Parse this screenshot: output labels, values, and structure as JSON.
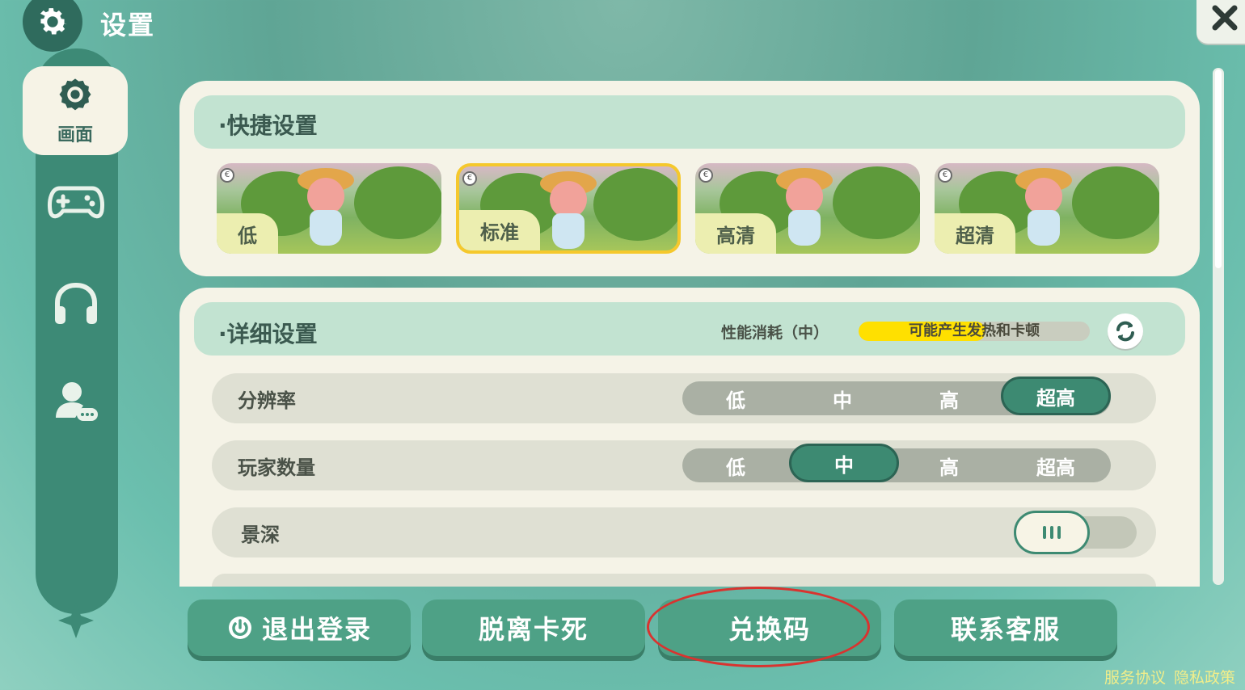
{
  "header": {
    "title": "设置",
    "settings_icon": "gear-icon",
    "close_icon": "close-icon"
  },
  "sidebar": {
    "items": [
      {
        "label": "画面",
        "icon": "display-icon",
        "active": true
      },
      {
        "label": "",
        "icon": "gamepad-icon",
        "active": false
      },
      {
        "label": "",
        "icon": "headphones-icon",
        "active": false
      },
      {
        "label": "",
        "icon": "user-chat-icon",
        "active": false
      }
    ]
  },
  "quick": {
    "title": "·快捷设置",
    "presets": [
      {
        "label": "低",
        "selected": false
      },
      {
        "label": "标准",
        "selected": true
      },
      {
        "label": "高清",
        "selected": false
      },
      {
        "label": "超清",
        "selected": false
      }
    ]
  },
  "detail": {
    "title": "·详细设置",
    "perf_label": "性能消耗（中）",
    "perf_text": "可能产生发热和卡顿",
    "perf_level": 0.55,
    "rows": [
      {
        "label": "分辨率",
        "options": [
          "低",
          "中",
          "高",
          "超高"
        ],
        "selected": 3
      },
      {
        "label": "玩家数量",
        "options": [
          "低",
          "中",
          "高",
          "超高"
        ],
        "selected": 1
      },
      {
        "label": "景深",
        "toggle": false
      }
    ]
  },
  "buttons": {
    "logout": "退出登录",
    "unstuck": "脱离卡死",
    "redeem": "兑换码",
    "support": "联系客服"
  },
  "footer": {
    "terms": "服务协议",
    "privacy": "隐私政策"
  },
  "colors": {
    "accent": "#3d8a72",
    "selected_border": "#f5c82c",
    "highlight_ring": "#d9332f"
  }
}
